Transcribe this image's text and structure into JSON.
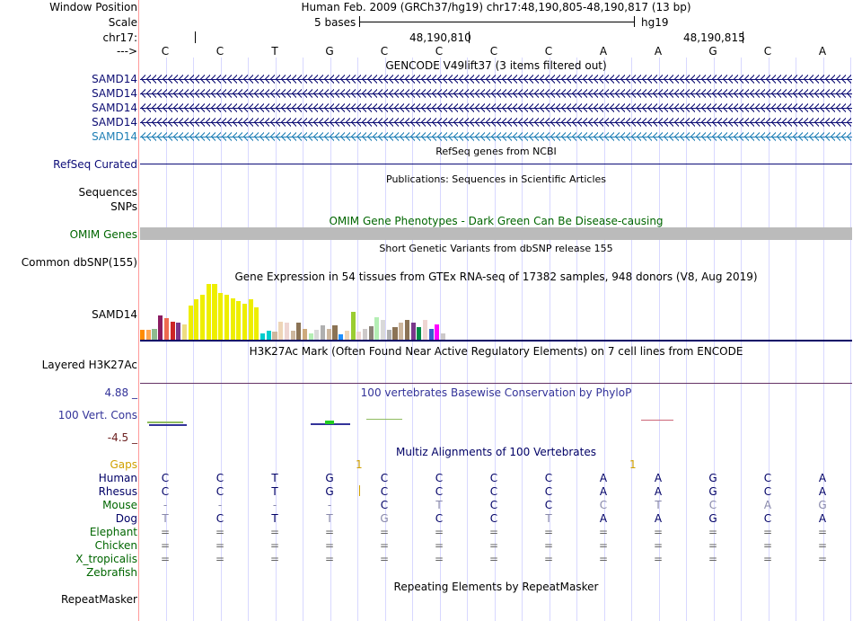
{
  "header": {
    "window_position_label": "Window Position",
    "scale_label": "Scale",
    "chrom_label": "chr17:",
    "arrow_label": "--->",
    "title": "Human Feb. 2009 (GRCh37/hg19)   chr17:48,190,805-48,190,817 (13 bp)",
    "scale_text": "5 bases",
    "assembly": "hg19",
    "coord_1": "48,190,810",
    "coord_2": "48,190,815"
  },
  "bases": [
    "C",
    "C",
    "T",
    "G",
    "C",
    "C",
    "C",
    "C",
    "A",
    "A",
    "G",
    "C",
    "A"
  ],
  "gencode": {
    "title": "GENCODE V49lift37 (3 items filtered out)",
    "items": [
      {
        "label": "SAMD14",
        "color": "#0d0d73"
      },
      {
        "label": "SAMD14",
        "color": "#0d0d73"
      },
      {
        "label": "SAMD14",
        "color": "#0d0d73"
      },
      {
        "label": "SAMD14",
        "color": "#0d0d73"
      },
      {
        "label": "SAMD14",
        "color": "#1f7fb5"
      }
    ]
  },
  "refseq": {
    "title": "RefSeq genes from NCBI",
    "label": "RefSeq Curated"
  },
  "publications": {
    "title": "Publications: Sequences in Scientific Articles",
    "label": "Sequences"
  },
  "snps_label": "SNPs",
  "omim": {
    "title": "OMIM Gene Phenotypes - Dark Green Can Be Disease-causing",
    "label": "OMIM Genes"
  },
  "dbsnp": {
    "title": "Short Genetic Variants from dbSNP release 155",
    "label": "Common dbSNP(155)"
  },
  "gtex": {
    "title": "Gene Expression in 54 tissues from GTEx RNA-seq of 17382 samples, 948 donors (V8, Aug 2019)",
    "label": "SAMD14",
    "bars": [
      {
        "color": "#ff8c00",
        "level": 0.18
      },
      {
        "color": "#ffa54f",
        "level": 0.18
      },
      {
        "color": "#8fbc8f",
        "level": 0.2
      },
      {
        "color": "#8b1c62",
        "level": 0.43
      },
      {
        "color": "#ee6a50",
        "level": 0.38
      },
      {
        "color": "#cd2626",
        "level": 0.32
      },
      {
        "color": "#7a378b",
        "level": 0.3
      },
      {
        "color": "#eedd82",
        "level": 0.28
      },
      {
        "color": "#eeee00",
        "level": 0.62
      },
      {
        "color": "#eeee00",
        "level": 0.72
      },
      {
        "color": "#eeee00",
        "level": 0.8
      },
      {
        "color": "#eeee00",
        "level": 1.0
      },
      {
        "color": "#eeee00",
        "level": 1.0
      },
      {
        "color": "#eeee00",
        "level": 0.84
      },
      {
        "color": "#eeee00",
        "level": 0.8
      },
      {
        "color": "#eeee00",
        "level": 0.74
      },
      {
        "color": "#eeee00",
        "level": 0.7
      },
      {
        "color": "#eeee00",
        "level": 0.64
      },
      {
        "color": "#eeee00",
        "level": 0.72
      },
      {
        "color": "#eeee00",
        "level": 0.58
      },
      {
        "color": "#00cdcd",
        "level": 0.12
      },
      {
        "color": "#00cdcd",
        "level": 0.16
      },
      {
        "color": "#cdb79e",
        "level": 0.14
      },
      {
        "color": "#eed5b7",
        "level": 0.32
      },
      {
        "color": "#eed5d2",
        "level": 0.3
      },
      {
        "color": "#cdb79e",
        "level": 0.16
      },
      {
        "color": "#8b7355",
        "level": 0.3
      },
      {
        "color": "#cdaa7d",
        "level": 0.2
      },
      {
        "color": "#b4eeb4",
        "level": 0.12
      },
      {
        "color": "#d9d9d9",
        "level": 0.18
      },
      {
        "color": "#b0b0b0",
        "level": 0.26
      },
      {
        "color": "#cdb79e",
        "level": 0.2
      },
      {
        "color": "#8b7355",
        "level": 0.26
      },
      {
        "color": "#1e90ff",
        "level": 0.1
      },
      {
        "color": "#eed5b7",
        "level": 0.16
      },
      {
        "color": "#9acd32",
        "level": 0.5
      },
      {
        "color": "#eed5d2",
        "level": 0.14
      },
      {
        "color": "#cdc9c9",
        "level": 0.2
      },
      {
        "color": "#8b8378",
        "level": 0.24
      },
      {
        "color": "#b4eeb4",
        "level": 0.4
      },
      {
        "color": "#d9d9d9",
        "level": 0.36
      },
      {
        "color": "#b0b0b0",
        "level": 0.18
      },
      {
        "color": "#8b7355",
        "level": 0.22
      },
      {
        "color": "#cdb79e",
        "level": 0.3
      },
      {
        "color": "#8b7355",
        "level": 0.36
      },
      {
        "color": "#7a378b",
        "level": 0.3
      },
      {
        "color": "#008b45",
        "level": 0.22
      },
      {
        "color": "#eed5d2",
        "level": 0.36
      },
      {
        "color": "#3a5fcd",
        "level": 0.2
      },
      {
        "color": "#ff00ff",
        "level": 0.28
      },
      {
        "color": "#cdc9c9",
        "level": 0.12
      }
    ]
  },
  "h3k27ac": {
    "title": "H3K27Ac Mark (Often Found Near Active Regulatory Elements) on 7 cell lines from ENCODE",
    "label": "Layered H3K27Ac"
  },
  "conservation": {
    "title": "100 vertebrates Basewise Conservation by PhyloP",
    "label": "100 Vert. Cons",
    "max": "4.88 _",
    "min": "-4.5 _"
  },
  "multiz": {
    "title": "Multiz Alignments of 100 Vertebrates",
    "gaps_label": "Gaps",
    "gap_marks": [
      "1",
      "1"
    ],
    "species": [
      {
        "name": "Human",
        "color": "#000066",
        "bases": [
          "C",
          "C",
          "T",
          "G",
          "C",
          "C",
          "C",
          "C",
          "A",
          "A",
          "G",
          "C",
          "A"
        ]
      },
      {
        "name": "Rhesus",
        "color": "#000066",
        "bases": [
          "C",
          "C",
          "T",
          "G",
          "C",
          "C",
          "C",
          "C",
          "A",
          "A",
          "G",
          "C",
          "A"
        ]
      },
      {
        "name": "Mouse",
        "color": "#006600",
        "bases": [
          "-",
          "-",
          "-",
          "-",
          "C",
          "T",
          "C",
          "C",
          "C",
          "T",
          "C",
          "A",
          "G"
        ]
      },
      {
        "name": "Dog",
        "color": "#000066",
        "bases": [
          "T",
          "C",
          "T",
          "T",
          "G",
          "C",
          "C",
          "T",
          "A",
          "A",
          "G",
          "C",
          "A"
        ]
      },
      {
        "name": "Elephant",
        "color": "#006600",
        "bases": [
          "=",
          "=",
          "=",
          "=",
          "=",
          "=",
          "=",
          "=",
          "=",
          "=",
          "=",
          "=",
          "="
        ]
      },
      {
        "name": "Chicken",
        "color": "#006600",
        "bases": [
          "=",
          "=",
          "=",
          "=",
          "=",
          "=",
          "=",
          "=",
          "=",
          "=",
          "=",
          "=",
          "="
        ]
      },
      {
        "name": "X_tropicalis",
        "color": "#006600",
        "bases": [
          "=",
          "=",
          "=",
          "=",
          "=",
          "=",
          "=",
          "=",
          "=",
          "=",
          "=",
          "=",
          "="
        ]
      },
      {
        "name": "Zebrafish",
        "color": "#006600",
        "bases": []
      }
    ]
  },
  "repeatmasker": {
    "title": "Repeating Elements by RepeatMasker",
    "label": "RepeatMasker"
  },
  "colors": {
    "gencode": "#0d0d73",
    "refseq": "#0c0c78",
    "omim": "#006600",
    "conservation": "#333399",
    "gaps": "#d0a000"
  }
}
